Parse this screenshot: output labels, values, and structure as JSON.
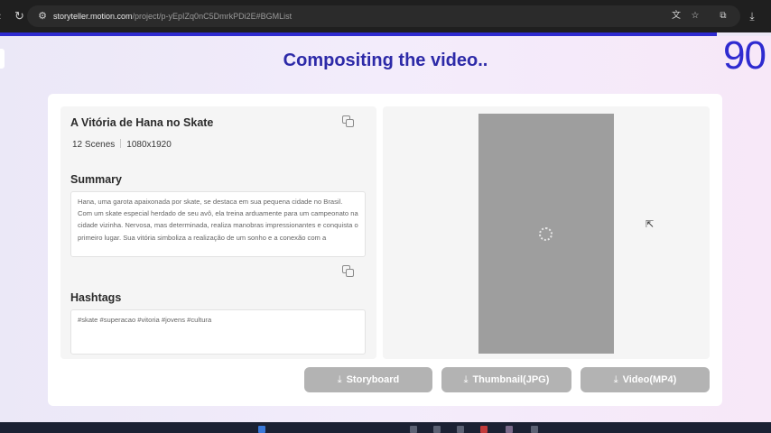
{
  "browser": {
    "url_host": "storyteller.motion.com",
    "url_path": "/project/p-yEpIZq0nC5DmrkPDi2E#BGMList",
    "back_icon": "back-arrow-icon",
    "reload_icon": "reload-icon",
    "site_info_icon": "site-settings-icon",
    "translate_icon": "translate-icon",
    "star_icon": "bookmark-star-icon",
    "extensions_icon": "extensions-icon",
    "download_icon": "download-icon"
  },
  "progress": {
    "percent": 93,
    "color": "#2f2bd0"
  },
  "header": {
    "title": "Compositing the video..",
    "counter": "90"
  },
  "project": {
    "title": "A Vitória de Hana no Skate",
    "scenes": "12 Scenes",
    "resolution": "1080x1920",
    "summary_heading": "Summary",
    "summary_text": "Hana, uma garota apaixonada por skate, se destaca em sua pequena cidade no Brasil. Com um skate especial herdado de seu avô, ela treina arduamente para um campeonato na cidade vizinha. Nervosa, mas determinada, realiza manobras impressionantes e conquista o primeiro lugar. Sua vitória simboliza a realização de um sonho e a conexão com a",
    "hashtags_heading": "Hashtags",
    "hashtags_text": "#skate #superacao #vitoria #jovens #cultura"
  },
  "buttons": {
    "storyboard": "Storyboard",
    "thumbnail": "Thumbnail(JPG)",
    "video": "Video(MP4)"
  },
  "colors": {
    "accent": "#2d2aa8",
    "button_disabled": "#b3b3b3",
    "video_placeholder": "#9e9e9e"
  }
}
